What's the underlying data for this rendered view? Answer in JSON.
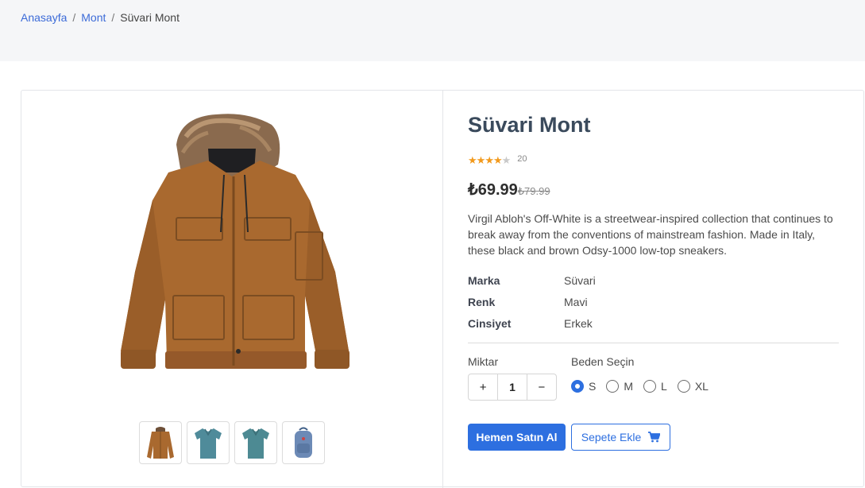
{
  "breadcrumb": {
    "home": "Anasayfa",
    "category": "Mont",
    "current": "Süvari Mont",
    "separator": "/"
  },
  "product": {
    "title": "Süvari Mont",
    "rating": {
      "stars": "★★★★★",
      "value": 4.5,
      "count": "20"
    },
    "price": "₺69.99",
    "old_price": "₺79.99",
    "description": "Virgil Abloh's Off-White is a streetwear-inspired collection that continues to break away from the conventions of mainstream fashion. Made in Italy, these black and brown Odsy-1000 low-top sneakers.",
    "specs": [
      {
        "key": "Marka",
        "value": "Süvari"
      },
      {
        "key": "Renk",
        "value": "Mavi"
      },
      {
        "key": "Cinsiyet",
        "value": "Erkek"
      }
    ],
    "thumbnails": [
      "jacket-icon",
      "shirt-icon",
      "shirt-icon",
      "backpack-icon"
    ]
  },
  "purchase": {
    "quantity_label": "Miktar",
    "quantity": "1",
    "plus": "+",
    "minus": "−",
    "size_label": "Beden Seçin",
    "sizes": [
      "S",
      "M",
      "L",
      "XL"
    ],
    "selected_size": "S",
    "buy_label": "Hemen Satın Al",
    "cart_label": "Sepete Ekle"
  },
  "colors": {
    "accent": "#2d6fe0",
    "link": "#3c6bd8",
    "star": "#f29a1d",
    "jacket": "#a9692f"
  }
}
